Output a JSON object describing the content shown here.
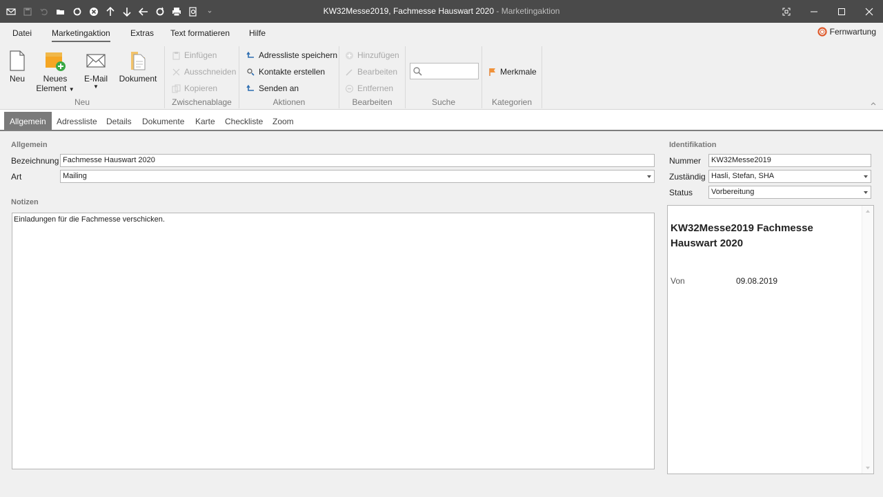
{
  "window": {
    "title_main": "KW32Messe2019, Fachmesse Hauswart 2020",
    "title_sep": " - ",
    "title_sub": "Marketingaktion"
  },
  "menu": {
    "items": [
      "Datei",
      "Marketingaktion",
      "Extras",
      "Text formatieren",
      "Hilfe"
    ],
    "active": "Marketingaktion",
    "remote_label": "Fernwartung"
  },
  "ribbon": {
    "neu": {
      "group_label": "Neu",
      "new_label": "Neu",
      "new_element_line1": "Neues",
      "new_element_line2": "Element",
      "email_label": "E-Mail",
      "document_label": "Dokument"
    },
    "clipboard": {
      "group_label": "Zwischenablage",
      "paste": "Einfügen",
      "cut": "Ausschneiden",
      "copy": "Kopieren"
    },
    "actions": {
      "group_label": "Aktionen",
      "save_list": "Adressliste speichern",
      "create_contacts": "Kontakte erstellen",
      "send_to": "Senden an"
    },
    "edit": {
      "group_label": "Bearbeiten",
      "add": "Hinzufügen",
      "edit": "Bearbeiten",
      "remove": "Entfernen"
    },
    "search": {
      "group_label": "Suche",
      "value": ""
    },
    "categories": {
      "group_label": "Kategorien",
      "features": "Merkmale"
    }
  },
  "tabs": [
    "Allgemein",
    "Adressliste",
    "Details",
    "Dokumente",
    "Karte",
    "Checkliste",
    "Zoom"
  ],
  "active_tab": "Allgemein",
  "general": {
    "section": "Allgemein",
    "designation_label": "Bezeichnung",
    "designation_value": "Fachmesse Hauswart 2020",
    "type_label": "Art",
    "type_value": "Mailing"
  },
  "notes": {
    "section": "Notizen",
    "text": "Einladungen für die Fachmesse verschicken."
  },
  "identification": {
    "section": "Identifikation",
    "number_label": "Nummer",
    "number_value": "KW32Messe2019",
    "responsible_label": "Zuständig",
    "responsible_value": "Hasli, Stefan, SHA",
    "status_label": "Status",
    "status_value": "Vorbereitung"
  },
  "preview": {
    "title": "KW32Messe2019 Fachmesse Hauswart 2020",
    "from_label": "Von",
    "from_value": "09.08.2019"
  },
  "colors": {
    "titlebar": "#4a4a4a",
    "accent_orange": "#f5a623",
    "accent_green": "#3aa845",
    "remote_icon": "#e05a2b"
  }
}
